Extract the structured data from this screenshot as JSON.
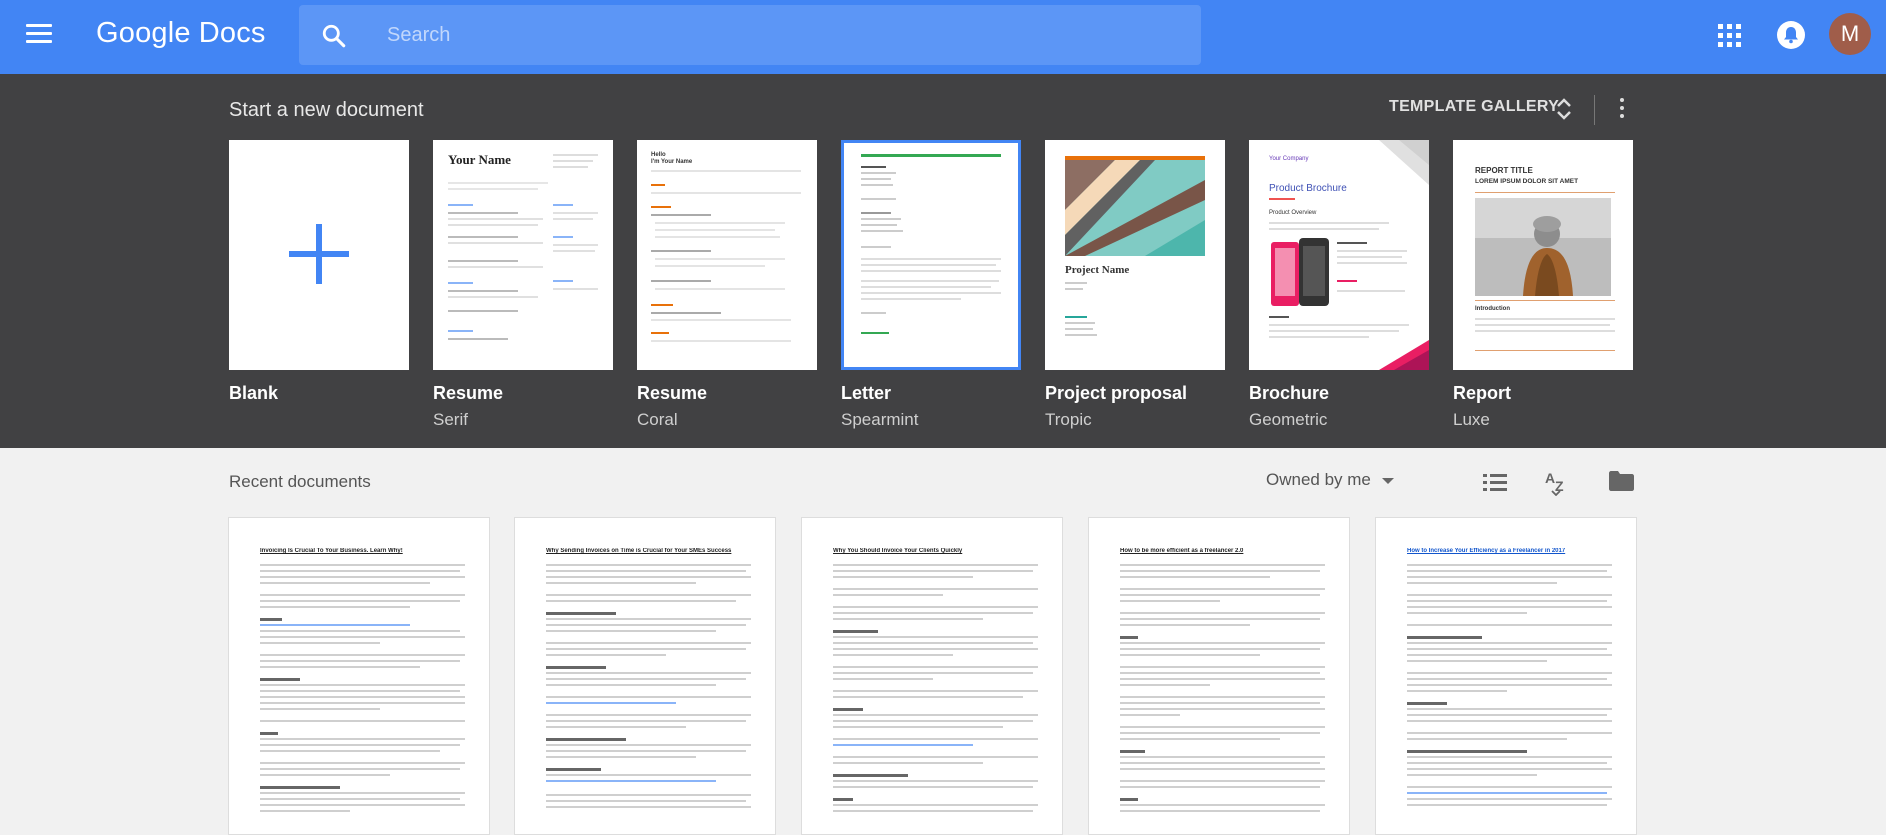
{
  "header": {
    "app_name_google": "Google",
    "app_name_docs": "Docs",
    "search_placeholder": "Search",
    "avatar_letter": "M",
    "brand_color": "#4285f4"
  },
  "templates": {
    "title": "Start a new document",
    "gallery_label": "TEMPLATE GALLERY",
    "items": [
      {
        "name": "Blank",
        "sub": ""
      },
      {
        "name": "Resume",
        "sub": "Serif"
      },
      {
        "name": "Resume",
        "sub": "Coral"
      },
      {
        "name": "Letter",
        "sub": "Spearmint"
      },
      {
        "name": "Project proposal",
        "sub": "Tropic"
      },
      {
        "name": "Brochure",
        "sub": "Geometric"
      },
      {
        "name": "Report",
        "sub": "Luxe"
      }
    ],
    "previews": {
      "resume_serif_name": "Your Name",
      "resume_coral_name": "Hello\nI'm Your Name",
      "project_name": "Project Name",
      "brochure_company": "Your Company",
      "brochure_title": "Product Brochure",
      "brochure_overview": "Product Overview",
      "report_title": "REPORT TITLE",
      "report_sub": "LOREM IPSUM DOLOR SIT AMET",
      "report_intro": "Introduction"
    }
  },
  "recent": {
    "title": "Recent documents",
    "owner_filter": "Owned by me",
    "docs": [
      {
        "title": "Invoicing Is Crucial To Your Business. Learn Why!"
      },
      {
        "title": "Why Sending Invoices on Time is Crucial for Your SMEs Success"
      },
      {
        "title": "Why You Should Invoice Your Clients Quickly"
      },
      {
        "title": "How to be more efficient as a freelancer 2.0"
      },
      {
        "title": "How to Increase Your Efficiency as a Freelancer in 2017"
      }
    ]
  }
}
